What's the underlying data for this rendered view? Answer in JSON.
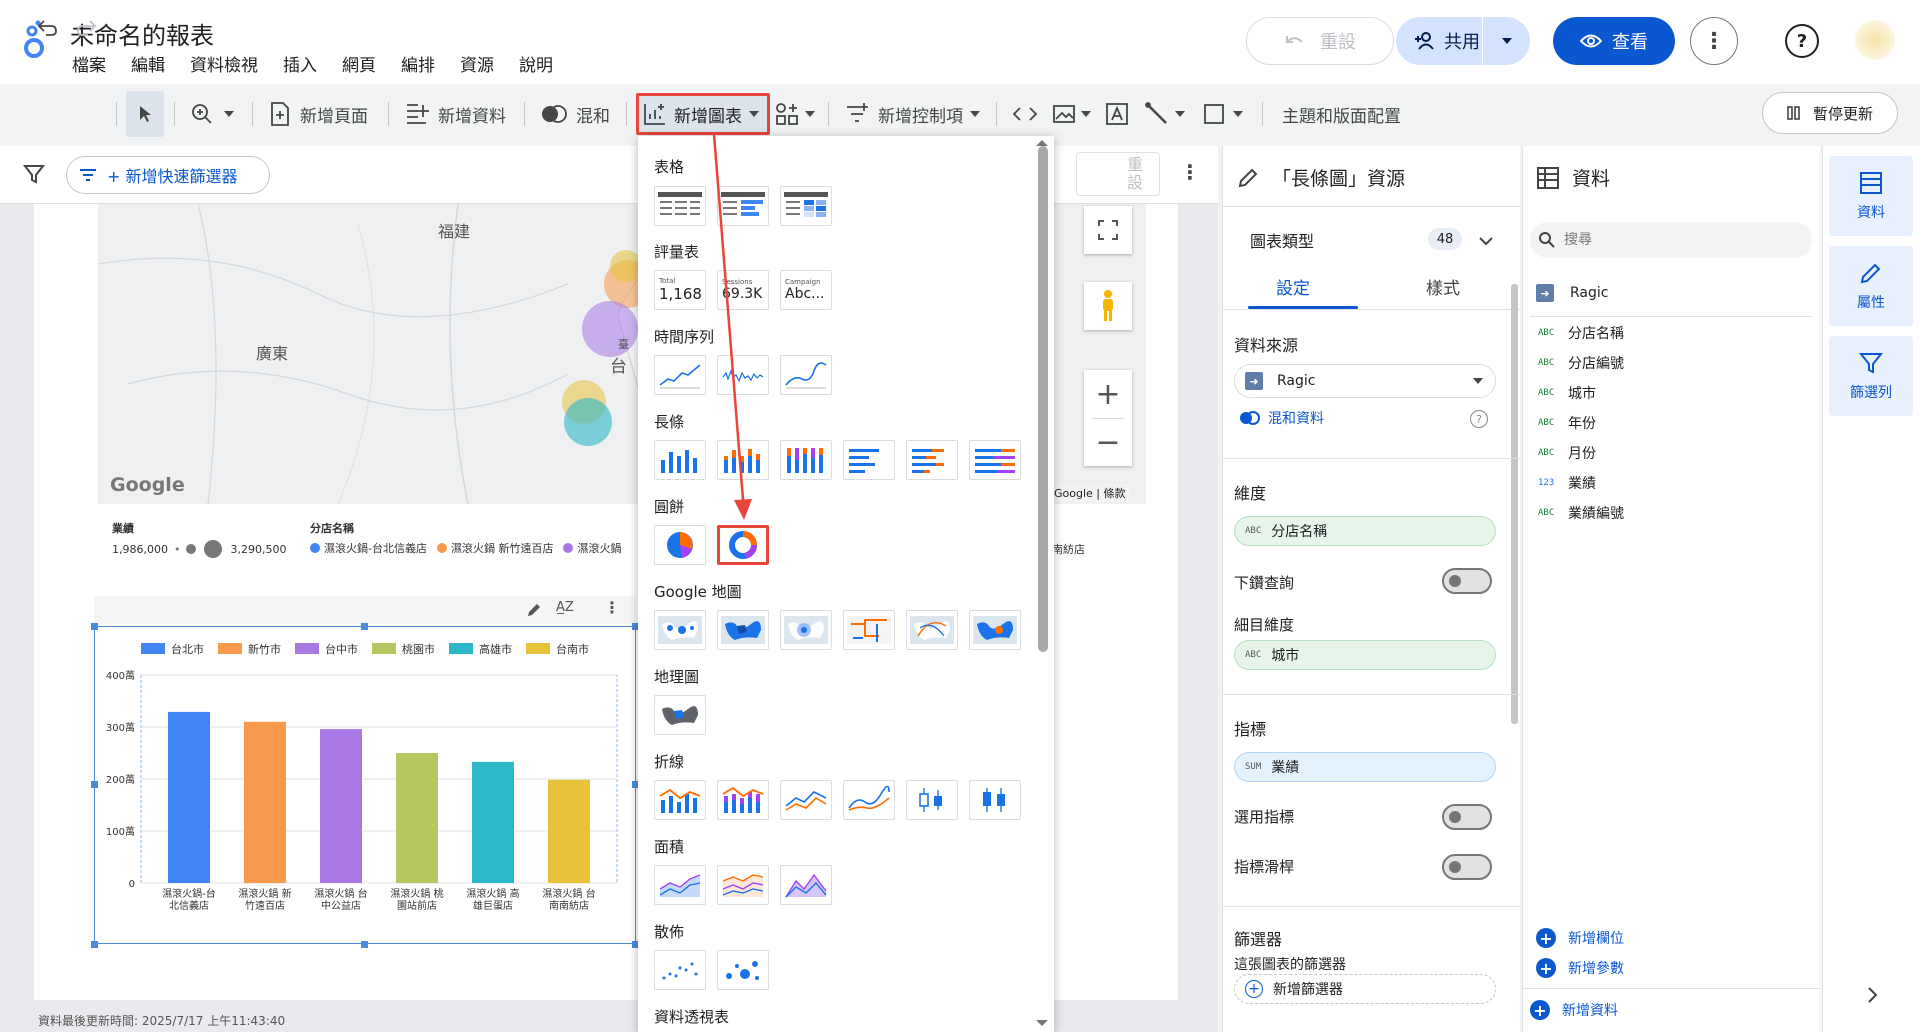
{
  "header": {
    "title": "未命名的報表",
    "menu": [
      "檔案",
      "編輯",
      "資料檢視",
      "插入",
      "網頁",
      "編排",
      "資源",
      "說明"
    ],
    "reset_label": "重設",
    "share_label": "共用",
    "view_label": "查看"
  },
  "toolbar": {
    "add_page": "新增頁面",
    "add_data": "新增資料",
    "blend": "混和",
    "add_chart": "新增圖表",
    "add_control": "新增控制項",
    "theme_layout": "主題和版面配置",
    "pause_update": "暫停更新"
  },
  "filterbar": {
    "quick_filter": "+ 新增快速篩選器"
  },
  "map": {
    "labels": [
      "福建",
      "廣東",
      "台",
      "臺"
    ],
    "google": "Google",
    "attrib": "Google",
    "terms": "條款",
    "legend": {
      "size_title": "業績",
      "size_min": "1,986,000",
      "size_max": "3,290,500",
      "color_title": "分店名稱",
      "items": [
        "濕滾火鍋-台北信義店",
        "濕滾火鍋 新竹遠百店",
        "濕滾火鍋"
      ],
      "trailing": "南紡店"
    }
  },
  "inner_reset": "重設",
  "chart_data": {
    "type": "bar",
    "categories": [
      "濕滾火鍋-台北信義店",
      "濕滾火鍋 新竹遠百店",
      "濕滾火鍋 台中公益店",
      "濕滾火鍋 桃園站前店",
      "濕滾火鍋 高雄巨蛋店",
      "濕滾火鍋 台南南紡店"
    ],
    "category_lines": [
      [
        "濕滾火鍋-台",
        "北信義店"
      ],
      [
        "濕滾火鍋 新",
        "竹遠百店"
      ],
      [
        "濕滾火鍋 台",
        "中公益店"
      ],
      [
        "濕滾火鍋 桃",
        "園站前店"
      ],
      [
        "濕滾火鍋 高",
        "雄巨蛋店"
      ],
      [
        "濕滾火鍋 台",
        "南南紡店"
      ]
    ],
    "series_names": [
      "台北市",
      "新竹市",
      "台中市",
      "桃園市",
      "高雄市",
      "台南市"
    ],
    "values": [
      3290500,
      3100000,
      2960000,
      2500000,
      2330000,
      1986000
    ],
    "colors": [
      "#4285f4",
      "#f79a4b",
      "#a879e5",
      "#b5c75e",
      "#2db8c9",
      "#e8c23a"
    ],
    "ylim": [
      0,
      4000000
    ],
    "yticks": [
      {
        "v": 0,
        "l": "0"
      },
      {
        "v": 1000000,
        "l": "100萬"
      },
      {
        "v": 2000000,
        "l": "200萬"
      },
      {
        "v": 3000000,
        "l": "300萬"
      },
      {
        "v": 4000000,
        "l": "400萬"
      }
    ],
    "legend_position": "top",
    "grid": true
  },
  "dropdown": {
    "categories": [
      "表格",
      "評量表",
      "時間序列",
      "長條",
      "圓餅",
      "Google 地圖",
      "地理圖",
      "折線",
      "面積",
      "散佈",
      "資料透視表"
    ],
    "scorecards": [
      {
        "label": "Total",
        "value": "1,168"
      },
      {
        "label": "Sessions",
        "value": "69.3K"
      },
      {
        "label": "Campaign",
        "value": "Abc..."
      }
    ]
  },
  "properties": {
    "title": "「長條圖」資源",
    "chart_type": "圖表類型",
    "chart_type_count": "48",
    "tab_setup": "設定",
    "tab_style": "樣式",
    "data_source_title": "資料來源",
    "data_source": "Ragic",
    "blend_data": "混和資料",
    "dimension_title": "維度",
    "dimension": "分店名稱",
    "drill_down": "下鑽查詢",
    "breakdown_title": "細目維度",
    "breakdown": "城市",
    "metric_title": "指標",
    "metric_agg": "SUM",
    "metric": "業績",
    "optional_metrics": "選用指標",
    "metric_slider": "指標滑桿",
    "filter_title": "篩選器",
    "filter_sub": "這張圖表的篩選器",
    "add_filter": "新增篩選器"
  },
  "data_panel": {
    "title": "資料",
    "search_placeholder": "搜尋",
    "source": "Ragic",
    "fields": [
      {
        "type": "ABC",
        "name": "分店名稱"
      },
      {
        "type": "ABC",
        "name": "分店編號"
      },
      {
        "type": "ABC",
        "name": "城市"
      },
      {
        "type": "ABC",
        "name": "年份"
      },
      {
        "type": "ABC",
        "name": "月份"
      },
      {
        "type": "123",
        "name": "業績"
      },
      {
        "type": "ABC",
        "name": "業績編號"
      }
    ],
    "add_field": "新增欄位",
    "add_param": "新增參數",
    "add_data": "新增資料"
  },
  "rail": {
    "data": "資料",
    "properties": "屬性",
    "filter_bar": "篩選列"
  },
  "status": {
    "last_updated": "資料最後更新時間: 2025/7/17 上午11:43:40"
  },
  "colors": {
    "accent": "#0b57d0",
    "highlight": "#e8453c"
  }
}
